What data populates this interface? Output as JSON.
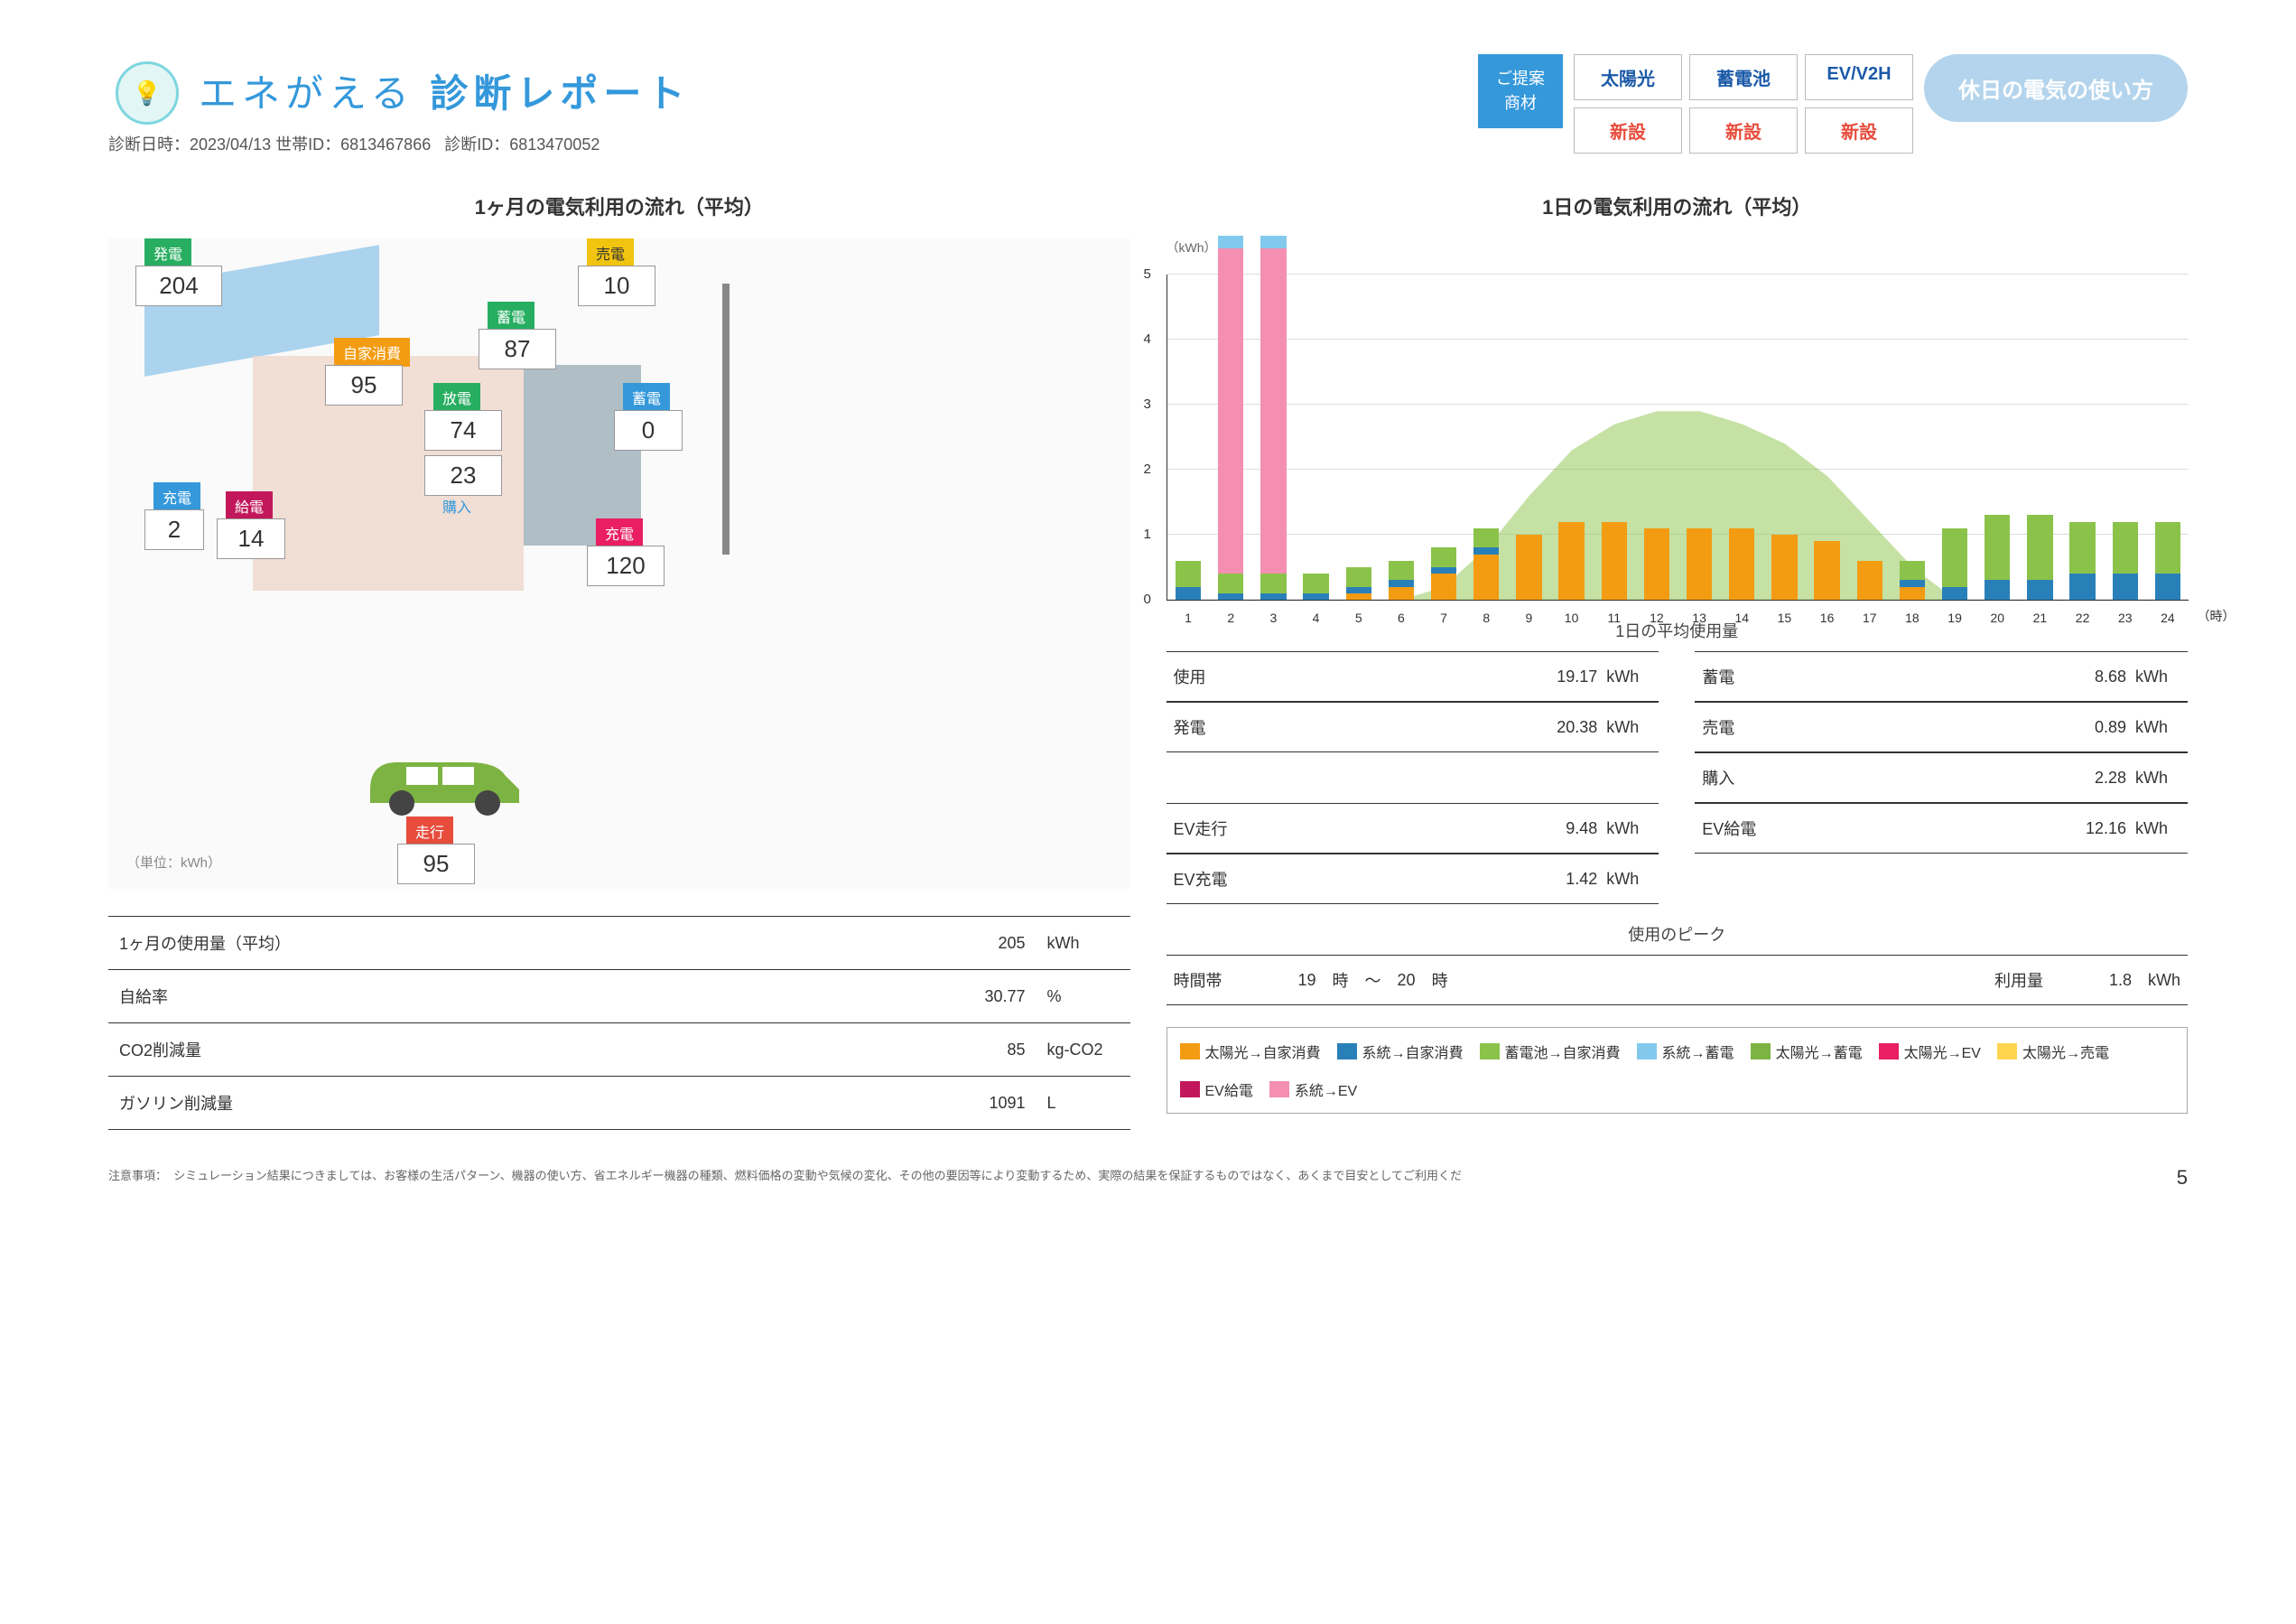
{
  "header": {
    "brand_a": "エネがえる",
    "brand_b": "診断レポート",
    "meta_date_label": "診断日時：",
    "meta_date": "2023/04/13",
    "meta_hhid_label": "世帯ID：",
    "meta_hhid": "6813467866",
    "meta_diagid_label": "診断ID：",
    "meta_diagid": "6813470052",
    "proposal_label": "ご提案\n商材",
    "cols": [
      "太陽光",
      "蓄電池",
      "EV/V2H"
    ],
    "vals": [
      "新設",
      "新設",
      "新設"
    ],
    "pill": "休日の電気の使い方"
  },
  "left": {
    "title": "1ヶ月の電気利用の流れ（平均）",
    "unit_note": "（単位：kWh）",
    "labels": {
      "gen": "発電",
      "gen_v": "204",
      "self": "自家消費",
      "self_v": "95",
      "store": "蓄電",
      "store_v": "87",
      "sell": "売電",
      "sell_v": "10",
      "dis": "放電",
      "dis_v": "74",
      "purch": "購入",
      "purch_v": "23",
      "store2": "蓄電",
      "store2_v": "0",
      "chg_left": "充電",
      "chg_left_v": "2",
      "sup": "給電",
      "sup_v": "14",
      "chg": "充電",
      "chg_v": "120",
      "run": "走行",
      "run_v": "95"
    },
    "table": [
      {
        "label": "1ヶ月の使用量（平均）",
        "value": "205",
        "unit": "kWh"
      },
      {
        "label": "自給率",
        "value": "30.77",
        "unit": "%"
      },
      {
        "label": "CO2削減量",
        "value": "85",
        "unit": "kg-CO2"
      },
      {
        "label": "ガソリン削減量",
        "value": "1091",
        "unit": "L"
      }
    ]
  },
  "right": {
    "title": "1日の電気利用の流れ（平均）",
    "ylabel": "（kWh）",
    "xlabel_suffix": "（時）",
    "avg_label": "1日の平均使用量",
    "table_left": [
      {
        "label": "使用",
        "value": "19.17",
        "unit": "kWh"
      },
      {
        "label": "発電",
        "value": "20.38",
        "unit": "kWh"
      },
      {
        "label": "",
        "value": "",
        "unit": ""
      },
      {
        "label": "EV走行",
        "value": "9.48",
        "unit": "kWh"
      },
      {
        "label": "EV充電",
        "value": "1.42",
        "unit": "kWh"
      }
    ],
    "table_right": [
      {
        "label": "蓄電",
        "value": "8.68",
        "unit": "kWh"
      },
      {
        "label": "売電",
        "value": "0.89",
        "unit": "kWh"
      },
      {
        "label": "購入",
        "value": "2.28",
        "unit": "kWh"
      },
      {
        "label": "EV給電",
        "value": "12.16",
        "unit": "kWh"
      },
      {
        "label": "",
        "value": "",
        "unit": ""
      }
    ],
    "peak_label": "使用のピーク",
    "peak_time_label": "時間帯",
    "peak_from": "19",
    "peak_h1": "時",
    "peak_sep": "～",
    "peak_to": "20",
    "peak_h2": "時",
    "peak_use_label": "利用量",
    "peak_use_value": "1.8",
    "peak_use_unit": "kWh",
    "legend": [
      {
        "color": "#f39c12",
        "label": "太陽光→自家消費"
      },
      {
        "color": "#2980b9",
        "label": "系統→自家消費"
      },
      {
        "color": "#8bc34a",
        "label": "蓄電池→自家消費"
      },
      {
        "color": "#82c9ed",
        "label": "系統→蓄電"
      },
      {
        "color": "#7cb342",
        "label": "太陽光→蓄電"
      },
      {
        "color": "#e91e63",
        "label": "太陽光→EV"
      },
      {
        "color": "#ffd54f",
        "label": "太陽光→売電"
      },
      {
        "color": "#c2185b",
        "label": "EV給電"
      },
      {
        "color": "#f48fb1",
        "label": "系統→EV"
      }
    ]
  },
  "chart_data": {
    "type": "bar",
    "title": "1日の電気利用の流れ（平均）",
    "xlabel": "時",
    "ylabel": "kWh",
    "ylim": [
      0,
      5
    ],
    "categories": [
      1,
      2,
      3,
      4,
      5,
      6,
      7,
      8,
      9,
      10,
      11,
      12,
      13,
      14,
      15,
      16,
      17,
      18,
      19,
      20,
      21,
      22,
      23,
      24
    ],
    "series": [
      {
        "name": "太陽光→自家消費",
        "color": "#f39c12",
        "values": [
          0,
          0,
          0,
          0,
          0.1,
          0.2,
          0.4,
          0.7,
          1.0,
          1.2,
          1.2,
          1.1,
          1.1,
          1.1,
          1.0,
          0.9,
          0.6,
          0.2,
          0,
          0,
          0,
          0,
          0,
          0
        ]
      },
      {
        "name": "系統→自家消費",
        "color": "#2980b9",
        "values": [
          0.2,
          0.1,
          0.1,
          0.1,
          0.1,
          0.1,
          0.1,
          0.1,
          0,
          0,
          0,
          0,
          0,
          0,
          0,
          0,
          0,
          0.1,
          0.2,
          0.3,
          0.3,
          0.4,
          0.4,
          0.4
        ]
      },
      {
        "name": "蓄電池→自家消費",
        "color": "#8bc34a",
        "values": [
          0.4,
          0.3,
          0.3,
          0.3,
          0.3,
          0.3,
          0.3,
          0.3,
          0,
          0,
          0,
          0,
          0,
          0,
          0,
          0,
          0,
          0.3,
          0.9,
          1.0,
          1.0,
          0.8,
          0.8,
          0.8
        ]
      },
      {
        "name": "系統→EV",
        "color": "#f48fb1",
        "values": [
          0,
          5.0,
          5.0,
          0,
          0,
          0,
          0,
          0,
          0,
          0,
          0,
          0,
          0,
          0,
          0,
          0,
          0,
          0,
          0,
          0,
          0,
          0,
          0,
          0
        ]
      },
      {
        "name": "系統→蓄電",
        "color": "#82c9ed",
        "values": [
          0,
          0.2,
          0.2,
          0,
          0,
          0,
          0,
          0,
          0,
          0,
          0,
          0,
          0,
          0,
          0,
          0,
          0,
          0,
          0,
          0,
          0,
          0,
          0,
          0
        ]
      },
      {
        "name": "太陽光→蓄電(area)",
        "color": "#8bc34a",
        "type": "area",
        "values": [
          0,
          0,
          0,
          0,
          0,
          0,
          0.2,
          0.8,
          1.6,
          2.3,
          2.7,
          2.9,
          2.9,
          2.7,
          2.4,
          1.9,
          1.2,
          0.5,
          0,
          0,
          0,
          0,
          0,
          0
        ]
      }
    ]
  },
  "footer": {
    "note_label": "注意事項：",
    "note": "シミュレーション結果につきましては、お客様の生活パターン、機器の使い方、省エネルギー機器の種類、燃料価格の変動や気候の変化、その他の要因等により変動するため、実際の結果を保証するものではなく、あくまで目安としてご利用くだ",
    "page": "5"
  }
}
